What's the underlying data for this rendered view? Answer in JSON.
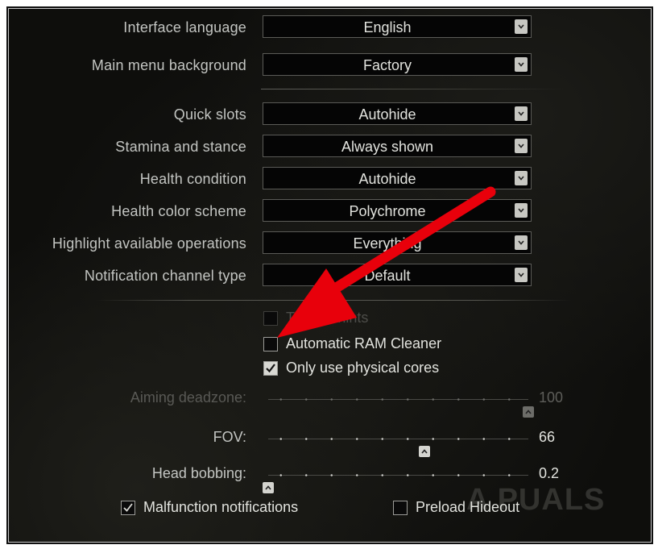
{
  "dropdowns": [
    {
      "label": "Interface language",
      "value": "English"
    },
    {
      "label": "Main menu background",
      "value": "Factory"
    },
    {
      "label": "Quick slots",
      "value": "Autohide"
    },
    {
      "label": "Stamina and stance",
      "value": "Always shown"
    },
    {
      "label": "Health condition",
      "value": "Autohide"
    },
    {
      "label": "Health color scheme",
      "value": "Polychrome"
    },
    {
      "label": "Highlight available operations",
      "value": "Everything"
    },
    {
      "label": "Notification channel type",
      "value": "Default"
    }
  ],
  "checkboxes": {
    "tutorial_hints": {
      "label": "Tutorial hints",
      "checked": false,
      "enabled": false
    },
    "ram_cleaner": {
      "label": "Automatic RAM Cleaner",
      "checked": false,
      "enabled": true
    },
    "physical_cores": {
      "label": "Only use physical cores",
      "checked": true,
      "enabled": true
    },
    "malfunction": {
      "label": "Malfunction notifications",
      "checked": true,
      "enabled": true
    },
    "preload_hideout": {
      "label": "Preload Hideout",
      "checked": false,
      "enabled": true
    }
  },
  "sliders": {
    "aiming_deadzone": {
      "label": "Aiming deadzone:",
      "value": "100",
      "enabled": false,
      "fraction": 1.0
    },
    "fov": {
      "label": "FOV:",
      "value": "66",
      "enabled": true,
      "fraction": 0.6
    },
    "head_bobbing": {
      "label": "Head bobbing:",
      "value": "0.2",
      "enabled": true,
      "fraction": 0.0
    }
  },
  "watermark": "A  PUALS",
  "colors": {
    "annotation_arrow": "#e8000b",
    "background": "#121210",
    "text": "#c3c5c2"
  },
  "icons": {
    "dropdown_caret": "chevron-down-icon",
    "slider_thumb": "chevron-up-icon"
  }
}
